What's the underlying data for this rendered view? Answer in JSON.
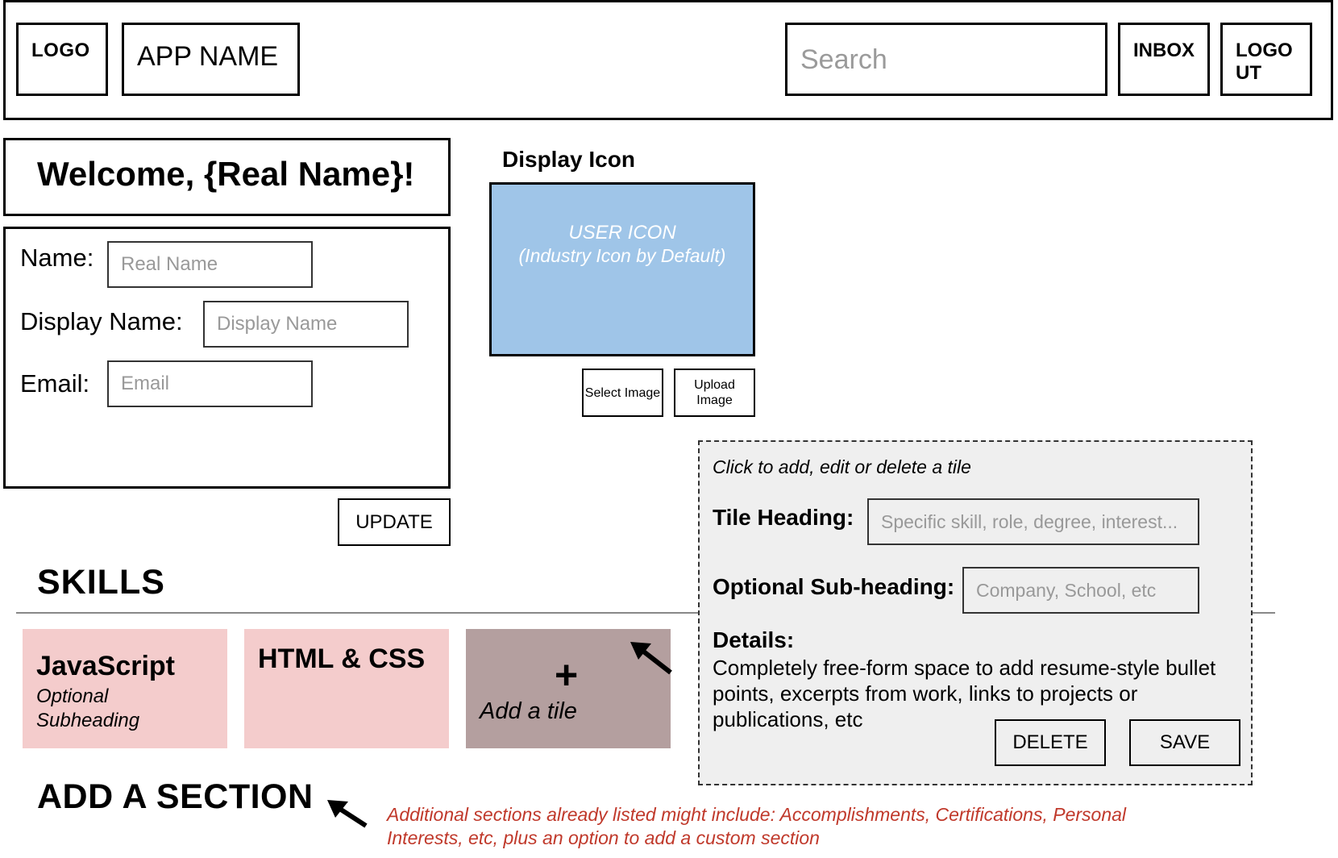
{
  "header": {
    "logo": "LOGO",
    "app_name": "APP NAME",
    "search_placeholder": "Search",
    "inbox": "INBOX",
    "logout": "LOGO UT"
  },
  "welcome": "Welcome, {Real Name}!",
  "profile_form": {
    "name_label": "Name:",
    "name_placeholder": "Real Name",
    "display_name_label": "Display Name:",
    "display_name_placeholder": "Display Name",
    "email_label": "Email:",
    "email_placeholder": "Email",
    "update_button": "UPDATE"
  },
  "display_icon": {
    "label": "Display Icon",
    "icon_line1": "USER ICON",
    "icon_line2": "(Industry Icon by Default)",
    "select_button": "Select Image",
    "upload_button": "Upload Image",
    "icon_color": "#9fc5e8"
  },
  "skills": {
    "heading": "SKILLS",
    "tiles": [
      {
        "heading": "JavaScript",
        "subheading": "Optional Subheading"
      },
      {
        "heading": "HTML & CSS",
        "subheading": ""
      }
    ],
    "add_tile_icon": "+",
    "add_tile_label": "Add a tile",
    "tile_color": "#f4cccc",
    "add_tile_color": "#b49f9f"
  },
  "edit_panel": {
    "hint": "Click to add, edit or delete a tile",
    "tile_heading_label": "Tile Heading:",
    "tile_heading_placeholder": "Specific skill, role, degree, interest...",
    "subheading_label": "Optional Sub-heading:",
    "subheading_placeholder": "Company, School, etc",
    "details_label": "Details:",
    "details_text": "Completely free-form space to add resume-style bullet points, excerpts from work, links to projects or publications, etc",
    "delete_button": "DELETE",
    "save_button": "SAVE"
  },
  "add_section": {
    "heading": "ADD A SECTION",
    "note": "Additional sections already listed might include: Accomplishments, Certifications, Personal Interests, etc,  plus an option to add a custom section",
    "note_color": "#c0392b"
  }
}
